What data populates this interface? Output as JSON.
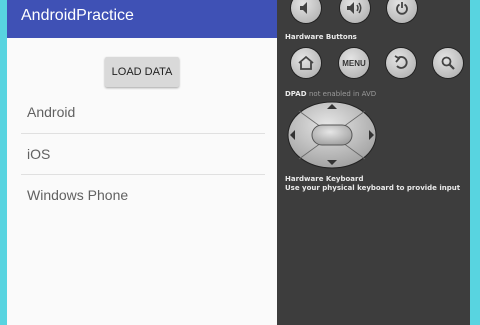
{
  "app": {
    "title": "AndroidPractice",
    "load_button_label": "LOAD DATA",
    "list_items": [
      "Android",
      "iOS",
      "Windows Phone"
    ]
  },
  "emulator": {
    "hardware_buttons_label": "Hardware Buttons",
    "menu_label": "MENU",
    "dpad_label": "DPAD",
    "dpad_status": "not enabled in AVD",
    "keyboard_title": "Hardware Keyboard",
    "keyboard_hint": "Use your physical keyboard to provide input",
    "icons": [
      "volume-down-icon",
      "volume-up-icon",
      "power-icon",
      "home-icon",
      "menu-button",
      "back-icon",
      "search-icon",
      "dpad"
    ]
  },
  "colors": {
    "app_bar": "#3f51b5",
    "panel": "#3d3d3d",
    "window_border": "#58d4e0"
  }
}
